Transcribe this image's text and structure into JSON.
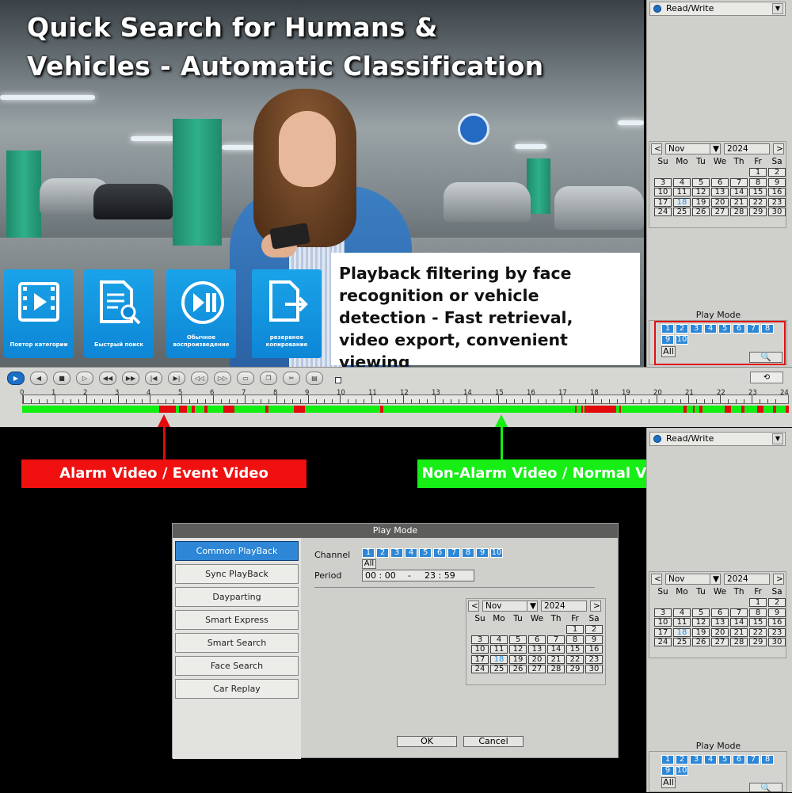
{
  "promo": {
    "headline_1": "Quick Search for Humans &",
    "headline_2": "Vehicles - Automatic Classification",
    "tiles": [
      {
        "icon": "video-play-icon",
        "label": "Повтор категории"
      },
      {
        "icon": "document-search-icon",
        "label": "Быстрый поиск"
      },
      {
        "icon": "play-pause-icon",
        "label": "Обычное воспроизведение"
      },
      {
        "icon": "file-export-icon",
        "label": "резервное копирование"
      }
    ],
    "info_line_1": "Playback filtering by face",
    "info_line_2": "recognition or vehicle",
    "info_line_3": "detection - Fast retrieval,",
    "info_line_4": "video export, convenient viewing"
  },
  "right_panel_top": {
    "disk_mode": "Read/Write",
    "calendar": {
      "prev": "<",
      "next": ">",
      "month": "Nov",
      "year": "2024",
      "weekdays": [
        "Su",
        "Mo",
        "Tu",
        "We",
        "Th",
        "Fr",
        "Sa"
      ],
      "selected_day": 18
    },
    "play_mode_title": "Play Mode",
    "channels": [
      "1",
      "2",
      "3",
      "4",
      "5",
      "6",
      "7",
      "8",
      "9",
      "10"
    ],
    "all_label": "All"
  },
  "right_panel_bottom": {
    "disk_mode": "Read/Write",
    "calendar": {
      "prev": "<",
      "next": ">",
      "month": "Nov",
      "year": "2024",
      "weekdays": [
        "Su",
        "Mo",
        "Tu",
        "We",
        "Th",
        "Fr",
        "Sa"
      ],
      "selected_day": 18
    },
    "play_mode_title": "Play Mode",
    "channels": [
      "1",
      "2",
      "3",
      "4",
      "5",
      "6",
      "7",
      "8",
      "9",
      "10"
    ],
    "all_label": "All"
  },
  "timeline": {
    "hours": [
      "0",
      "1",
      "2",
      "3",
      "4",
      "5",
      "6",
      "7",
      "8",
      "9",
      "10",
      "11",
      "12",
      "13",
      "14",
      "15",
      "16",
      "17",
      "18",
      "19",
      "20",
      "21",
      "22",
      "23",
      "24"
    ],
    "alarm_segments": [
      [
        4.3,
        4.8
      ],
      [
        4.9,
        5.15
      ],
      [
        5.3,
        5.4
      ],
      [
        5.7,
        5.8
      ],
      [
        6.3,
        6.65
      ],
      [
        7.6,
        7.7
      ],
      [
        8.5,
        8.85
      ],
      [
        11.2,
        11.3
      ],
      [
        17.3,
        17.35
      ],
      [
        17.5,
        17.55
      ],
      [
        17.6,
        17.7
      ],
      [
        17.7,
        18.6
      ],
      [
        18.7,
        18.75
      ],
      [
        20.7,
        20.8
      ],
      [
        21.0,
        21.05
      ],
      [
        21.2,
        21.3
      ],
      [
        22.0,
        22.2
      ],
      [
        22.5,
        22.6
      ],
      [
        23.0,
        23.2
      ],
      [
        23.5,
        23.6
      ],
      [
        23.9,
        24.0
      ]
    ],
    "colors": {
      "normal": "#11ee11",
      "alarm": "#e20a0a"
    }
  },
  "callouts": {
    "alarm": "Alarm Video / Event Video",
    "normal": "Non-Alarm Video / Normal Video"
  },
  "dialog": {
    "title": "Play Mode",
    "modes": [
      "Common PlayBack",
      "Sync PlayBack",
      "Dayparting",
      "Smart Express",
      "Smart Search",
      "Face Search",
      "Car Replay"
    ],
    "active_mode": "Common PlayBack",
    "channel_label": "Channel",
    "channels": [
      "1",
      "2",
      "3",
      "4",
      "5",
      "6",
      "7",
      "8",
      "9",
      "10"
    ],
    "all_label": "All",
    "period_label": "Period",
    "period_start": "00 : 00",
    "period_sep": "-",
    "period_end": "23 : 59",
    "calendar": {
      "prev": "<",
      "next": ">",
      "month": "Nov",
      "year": "2024",
      "weekdays": [
        "Su",
        "Mo",
        "Tu",
        "We",
        "Th",
        "Fr",
        "Sa"
      ],
      "selected_day": 18
    },
    "ok_label": "OK",
    "cancel_label": "Cancel"
  }
}
